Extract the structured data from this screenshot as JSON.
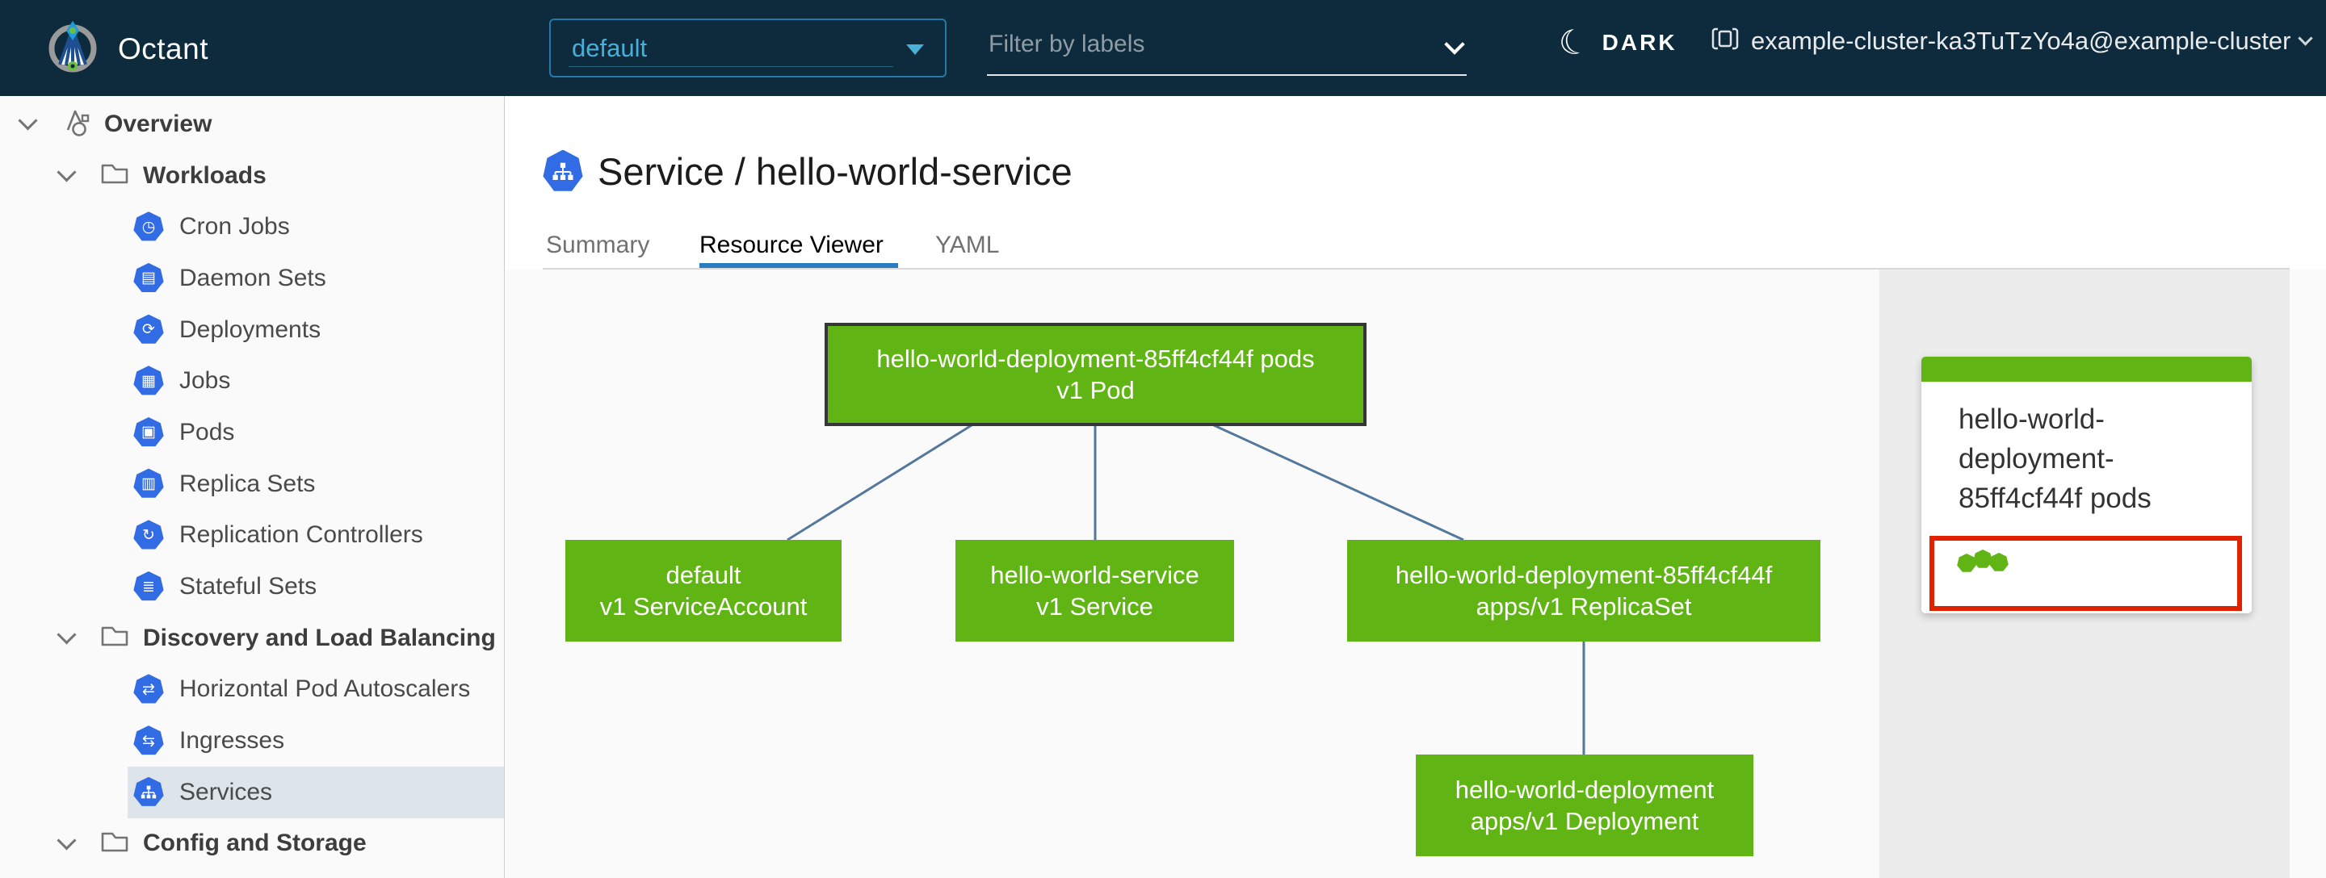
{
  "header": {
    "app_title": "Octant",
    "logo_icon": "octant-logo-icon",
    "namespace_select": {
      "value": "default",
      "caret_icon": "caret-down-icon"
    },
    "filter": {
      "placeholder": "Filter by labels",
      "chevron_icon": "chevron-down-icon"
    },
    "theme_toggle": {
      "label": "DARK",
      "icon": "moon-icon"
    },
    "cluster": {
      "label": "example-cluster-ka3TuTzYo4a@example-cluster",
      "icon": "cluster-icon",
      "chevron_icon": "chevron-down-icon"
    }
  },
  "sidebar": {
    "items": [
      {
        "label": "Overview",
        "depth": 0,
        "kind": "group",
        "icon": "objects-icon",
        "expanded": true,
        "selected": false
      },
      {
        "label": "Workloads",
        "depth": 1,
        "kind": "group",
        "icon": "folder-icon",
        "expanded": true,
        "selected": false
      },
      {
        "label": "Cron Jobs",
        "depth": 2,
        "kind": "item",
        "icon": "cron-jobs-icon",
        "selected": false
      },
      {
        "label": "Daemon Sets",
        "depth": 2,
        "kind": "item",
        "icon": "daemon-sets-icon",
        "selected": false
      },
      {
        "label": "Deployments",
        "depth": 2,
        "kind": "item",
        "icon": "deployments-icon",
        "selected": false
      },
      {
        "label": "Jobs",
        "depth": 2,
        "kind": "item",
        "icon": "jobs-icon",
        "selected": false
      },
      {
        "label": "Pods",
        "depth": 2,
        "kind": "item",
        "icon": "pods-icon",
        "selected": false
      },
      {
        "label": "Replica Sets",
        "depth": 2,
        "kind": "item",
        "icon": "replica-sets-icon",
        "selected": false
      },
      {
        "label": "Replication Controllers",
        "depth": 2,
        "kind": "item",
        "icon": "replication-controllers-icon",
        "selected": false
      },
      {
        "label": "Stateful Sets",
        "depth": 2,
        "kind": "item",
        "icon": "stateful-sets-icon",
        "selected": false
      },
      {
        "label": "Discovery and Load Balancing",
        "depth": 1,
        "kind": "group",
        "icon": "folder-icon",
        "expanded": true,
        "selected": false
      },
      {
        "label": "Horizontal Pod Autoscalers",
        "depth": 2,
        "kind": "item",
        "icon": "hpa-icon",
        "selected": false
      },
      {
        "label": "Ingresses",
        "depth": 2,
        "kind": "item",
        "icon": "ingresses-icon",
        "selected": false
      },
      {
        "label": "Services",
        "depth": 2,
        "kind": "item",
        "icon": "services-icon",
        "selected": true
      },
      {
        "label": "Config and Storage",
        "depth": 1,
        "kind": "group",
        "icon": "folder-icon",
        "expanded": true,
        "selected": false
      }
    ]
  },
  "main": {
    "title": "Service / hello-world-service",
    "title_icon": "service-icon",
    "tabs": [
      {
        "label": "Summary",
        "active": false
      },
      {
        "label": "Resource Viewer",
        "active": true
      },
      {
        "label": "YAML",
        "active": false
      }
    ]
  },
  "graph": {
    "nodes": [
      {
        "id": "pod",
        "lines": [
          "hello-world-deployment-85ff4cf44f pods",
          "v1 Pod"
        ],
        "selected": true,
        "color": "#60b515"
      },
      {
        "id": "serviceaccount",
        "lines": [
          "default",
          "v1 ServiceAccount"
        ],
        "selected": false,
        "color": "#60b515"
      },
      {
        "id": "service",
        "lines": [
          "hello-world-service",
          "v1 Service"
        ],
        "selected": false,
        "color": "#60b515"
      },
      {
        "id": "replicaset",
        "lines": [
          "hello-world-deployment-85ff4cf44f",
          "apps/v1 ReplicaSet"
        ],
        "selected": false,
        "color": "#60b515"
      },
      {
        "id": "deployment",
        "lines": [
          "hello-world-deployment",
          "apps/v1 Deployment"
        ],
        "selected": false,
        "color": "#60b515"
      }
    ],
    "edges": [
      {
        "from": "pod",
        "to": "serviceaccount"
      },
      {
        "from": "pod",
        "to": "service"
      },
      {
        "from": "pod",
        "to": "replicaset"
      },
      {
        "from": "replicaset",
        "to": "deployment"
      }
    ]
  },
  "detail_panel": {
    "card": {
      "title": "hello-world-deployment-85ff4cf44f pods",
      "pod_count": 3,
      "selected": true
    }
  },
  "colors": {
    "header_bg": "#0d2b3c",
    "accent_blue": "#49afd9",
    "k8s_icon_blue": "#326ce5",
    "node_green": "#60b515",
    "edge_blue": "#54779c",
    "selection_red": "#e12200",
    "tab_underline": "#2b7cbf",
    "sidebar_selected_bg": "#dde5ea",
    "panel_bg": "#ececec"
  }
}
